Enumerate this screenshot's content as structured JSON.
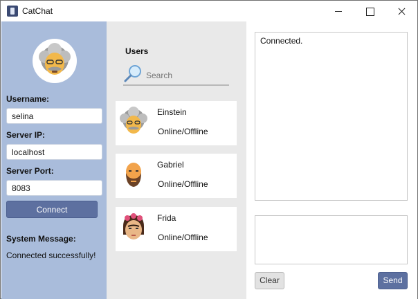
{
  "window": {
    "title": "CatChat",
    "app_icon": "catchat-app-icon",
    "controls": [
      "minimize-icon",
      "maximize-icon",
      "close-icon"
    ]
  },
  "login_panel": {
    "avatar_icon": "einstein-avatar-icon",
    "username_label": "Username:",
    "username_value": "selina",
    "server_ip_label": "Server IP:",
    "server_ip_value": "localhost",
    "server_port_label": "Server Port:",
    "server_port_value": "8083",
    "connect_label": "Connect",
    "system_message_label": "System Message:",
    "system_message_value": "Connected successfully!"
  },
  "users_panel": {
    "title": "Users",
    "search_placeholder": "Search",
    "users": [
      {
        "name": "Einstein",
        "status": "Online/Offline",
        "avatar": "einstein-avatar-icon"
      },
      {
        "name": "Gabriel",
        "status": "Online/Offline",
        "avatar": "gabriel-avatar-icon"
      },
      {
        "name": "Frida",
        "status": "Online/Offline",
        "avatar": "frida-avatar-icon"
      }
    ]
  },
  "chat_panel": {
    "log_text": "Connected.",
    "message_value": "",
    "clear_label": "Clear",
    "send_label": "Send"
  },
  "colors": {
    "left_panel_bg": "#a9bcdb",
    "middle_panel_bg": "#e9e9e9",
    "accent_button": "#5d70a0"
  }
}
